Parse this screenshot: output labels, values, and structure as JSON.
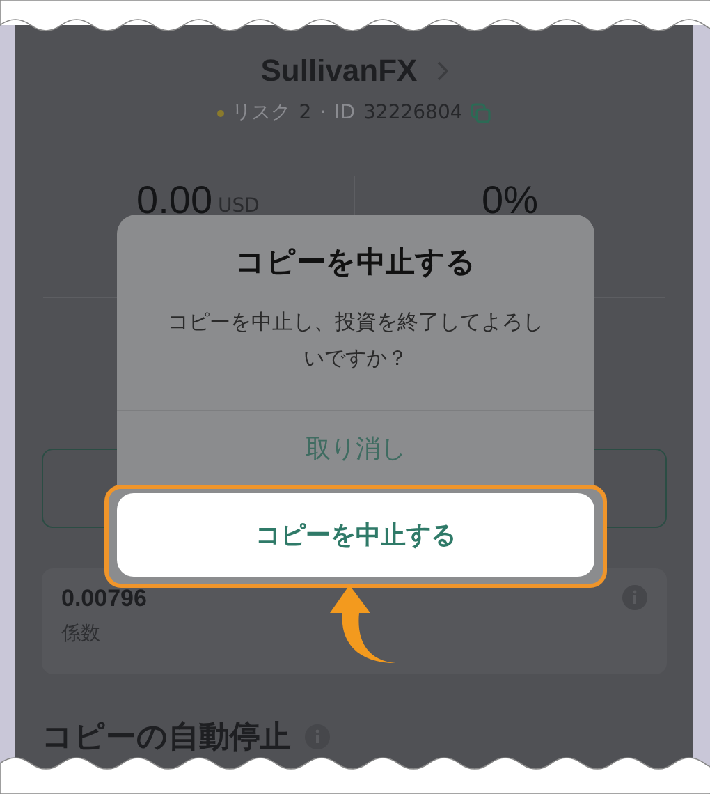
{
  "header": {
    "name": "SullivanFX",
    "risk_label": "リスク",
    "risk_value": "2",
    "separator": "·",
    "id_label": "ID",
    "id_value": "32226804"
  },
  "stats": [
    {
      "value": "0.00",
      "unit": "USD"
    },
    {
      "value": "0%"
    }
  ],
  "coefficient": {
    "value": "0.00796",
    "label": "係数"
  },
  "section_heading": "コピーの自動停止",
  "dialog": {
    "title": "コピーを中止する",
    "message": "コピーを中止し、投資を終了してよろしいですか？",
    "actions": [
      {
        "label": "取り消し",
        "highlighted": false
      },
      {
        "label": "コピーを中止する",
        "highlighted": true
      }
    ]
  }
}
